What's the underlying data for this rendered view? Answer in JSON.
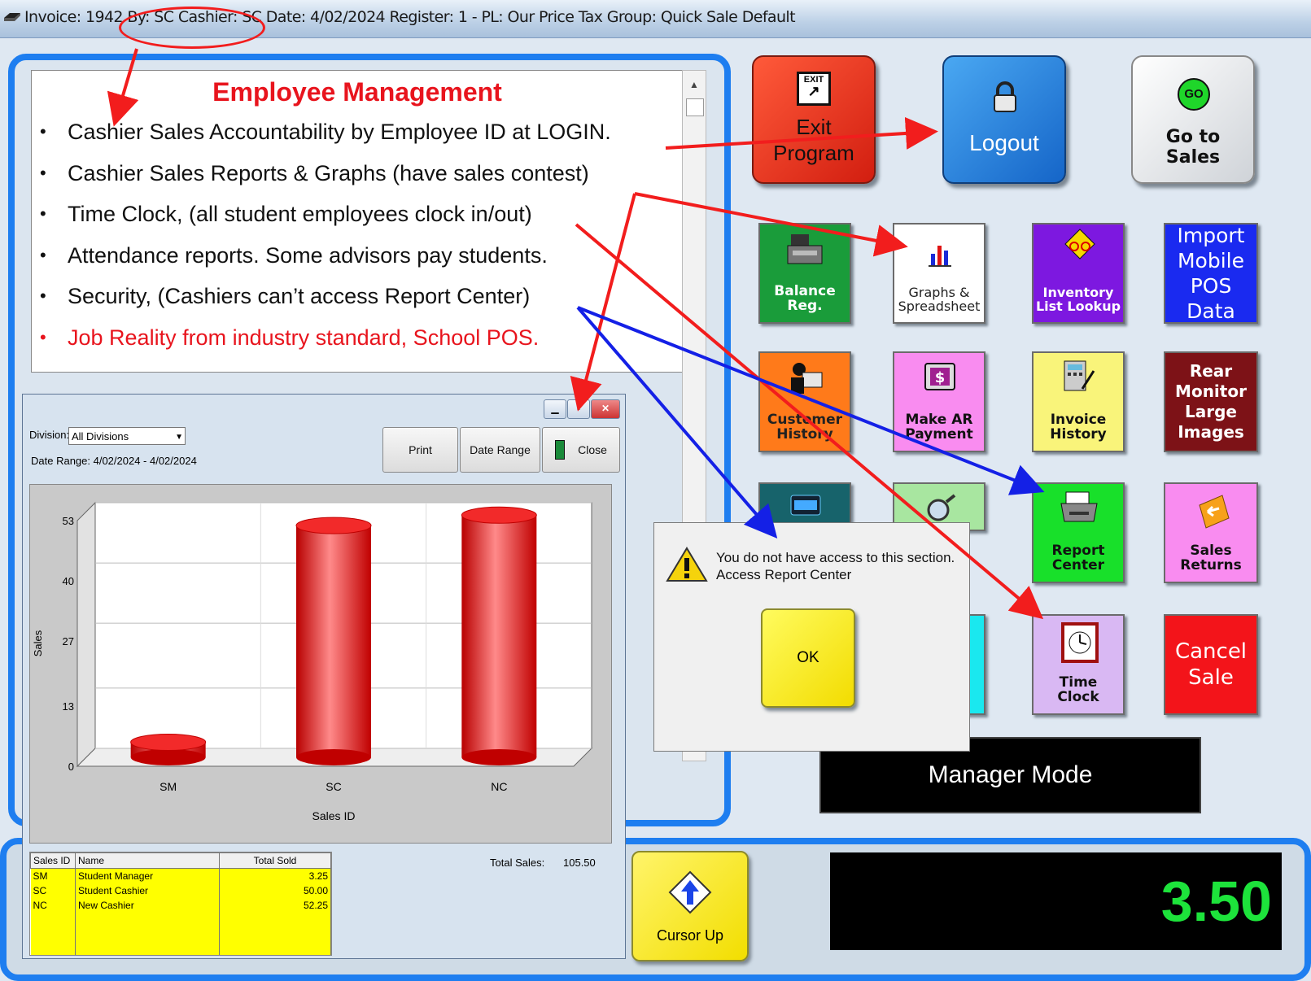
{
  "titlebar": {
    "info": "Invoice: 1942  By: SC   Cashier: SC   Date:  4/02/2024  Register: 1 - PL: Our Price  Tax Group: Quick Sale Default"
  },
  "notes": {
    "heading": "Employee Management",
    "items": [
      "Cashier Sales Accountability by Employee ID at LOGIN.",
      "Cashier Sales Reports & Graphs (have sales contest)",
      "Time Clock, (all student employees clock in/out)",
      "Attendance reports. Some advisors pay students.",
      "Security, (Cashiers can’t access Report Center)",
      "Job Reality from industry standard, School POS."
    ]
  },
  "top_buttons": {
    "exit": "Exit Program",
    "exit_icon_text": "EXIT",
    "logout": "Logout",
    "go_to_sales": "Go to Sales",
    "go_icon_text": "GO"
  },
  "tiles": {
    "balance_reg": "Balance Reg.",
    "graphs": "Graphs & Spreadsheet",
    "inventory": "Inventory List Lookup",
    "import_mobile": "Import Mobile POS Data",
    "customer_history": "Customer History",
    "make_ar": "Make AR Payment",
    "invoice_history": "Invoice History",
    "rear_monitor": "Rear Monitor Large Images",
    "report_center": "Report Center",
    "sales_returns": "Sales Returns",
    "time_clock": "Time Clock",
    "cancel_sale": "Cancel Sale"
  },
  "manager_mode": "Manager Mode",
  "report_window": {
    "division_label": "Division:",
    "division_value": "All Divisions",
    "date_range_text": "Date Range:  4/02/2024 -  4/02/2024",
    "print_label": "Print",
    "date_range_button": "Date Range",
    "close_label": "Close",
    "total_sales_label": "Total Sales:",
    "total_sales_value": "105.50",
    "table": {
      "headers": [
        "Sales ID",
        "Name",
        "Total Sold"
      ],
      "rows": [
        [
          "SM",
          "Student Manager",
          "3.25"
        ],
        [
          "SC",
          "Student Cashier",
          "50.00"
        ],
        [
          "NC",
          "New Cashier",
          "52.25"
        ]
      ]
    }
  },
  "chart_data": {
    "type": "bar",
    "categories": [
      "SM",
      "SC",
      "NC"
    ],
    "values": [
      3.25,
      50.0,
      52.25
    ],
    "ylim": [
      0,
      53
    ],
    "yticks": [
      "0",
      "13",
      "27",
      "40",
      "53"
    ],
    "xlabel": "Sales ID",
    "ylabel": "Sales",
    "bar_color": "#ee1111"
  },
  "alert": {
    "message_line1": "You do not have access to this section.",
    "message_line2": "Access Report Center",
    "ok_label": "OK"
  },
  "cursor_up_label": "Cursor Up",
  "total_display": "3.50",
  "colors": {
    "annotation_red": "#f21d1d",
    "annotation_blue": "#1420e6",
    "frame_blue": "#1e7ef0"
  }
}
